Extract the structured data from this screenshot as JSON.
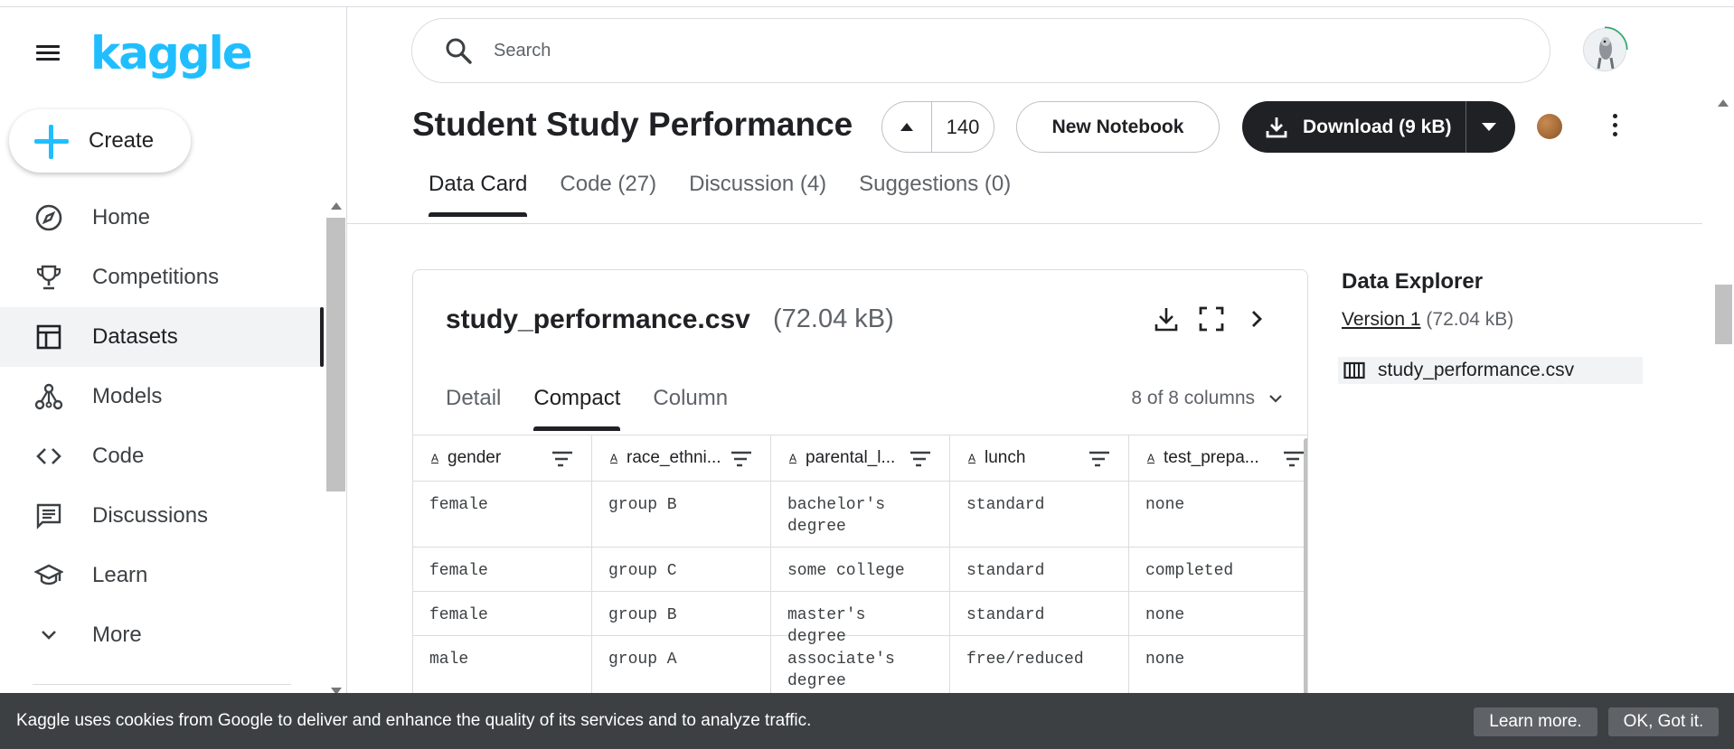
{
  "brand": {
    "logo_text": "kaggle",
    "accent_color": "#20beff"
  },
  "sidebar": {
    "create_label": "Create",
    "items": [
      {
        "label": "Home",
        "icon": "compass-icon"
      },
      {
        "label": "Competitions",
        "icon": "trophy-icon"
      },
      {
        "label": "Datasets",
        "icon": "table-icon",
        "active": true
      },
      {
        "label": "Models",
        "icon": "models-icon"
      },
      {
        "label": "Code",
        "icon": "code-icon"
      },
      {
        "label": "Discussions",
        "icon": "comments-icon"
      },
      {
        "label": "Learn",
        "icon": "graduation-cap-icon"
      },
      {
        "label": "More",
        "icon": "chevron-down-icon"
      }
    ]
  },
  "search": {
    "placeholder": "Search"
  },
  "dataset": {
    "title": "Student Study Performance",
    "upvotes": "140",
    "new_notebook_label": "New Notebook",
    "download_label": "Download (9 kB)"
  },
  "tabs": [
    {
      "label": "Data Card",
      "active": true
    },
    {
      "label": "Code (27)"
    },
    {
      "label": "Discussion (4)"
    },
    {
      "label": "Suggestions (0)"
    }
  ],
  "file_card": {
    "file_name": "study_performance.csv",
    "file_size": "(72.04 kB)",
    "subtabs": [
      {
        "label": "Detail"
      },
      {
        "label": "Compact",
        "active": true
      },
      {
        "label": "Column"
      }
    ],
    "column_count": "8 of 8 columns",
    "type_icon": "A",
    "columns": [
      "gender",
      "race_ethni...",
      "parental_l...",
      "lunch",
      "test_prepa..."
    ],
    "rows": [
      [
        "female",
        "group B",
        "bachelor's degree",
        "standard",
        "none"
      ],
      [
        "female",
        "group C",
        "some college",
        "standard",
        "completed"
      ],
      [
        "female",
        "group B",
        "master's degree",
        "standard",
        "none"
      ],
      [
        "male",
        "group A",
        "associate's degree",
        "free/reduced",
        "none"
      ]
    ]
  },
  "explorer": {
    "title": "Data Explorer",
    "version_link": "Version 1",
    "version_size": "(72.04 kB)",
    "file_label": "study_performance.csv"
  },
  "cookie": {
    "text": "Kaggle uses cookies from Google to deliver and enhance the quality of its services and to analyze traffic.",
    "learn_more": "Learn more.",
    "ok": "OK, Got it."
  }
}
